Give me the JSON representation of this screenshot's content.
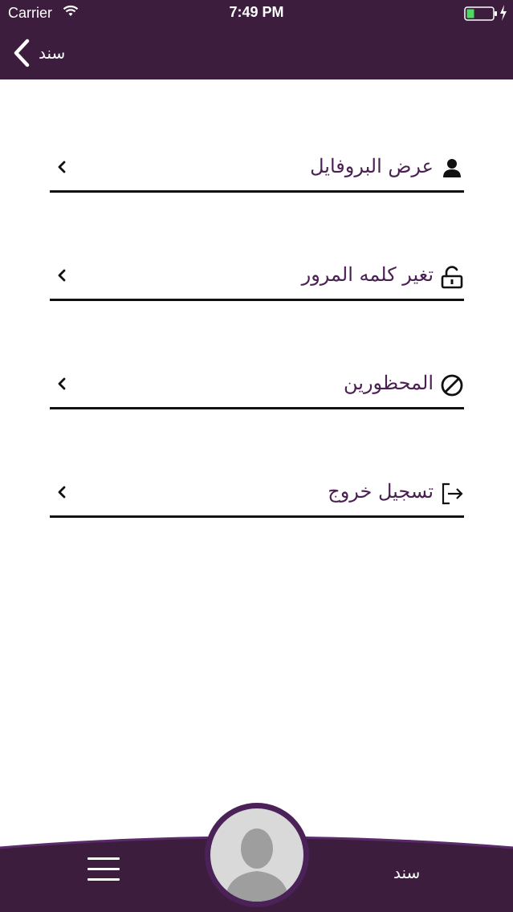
{
  "status_bar": {
    "carrier": "Carrier",
    "time": "7:49 PM"
  },
  "header": {
    "back_label": "سند"
  },
  "menu": {
    "items": [
      {
        "label": "عرض البروفايل",
        "icon": "user-icon"
      },
      {
        "label": "تغير كلمه المرور",
        "icon": "lock-icon"
      },
      {
        "label": "المحظورين",
        "icon": "blocked-icon"
      },
      {
        "label": "تسجيل خروج",
        "icon": "logout-icon"
      }
    ]
  },
  "bottom_bar": {
    "brand": "سند"
  },
  "colors": {
    "header_bg": "#3d1d3d",
    "accent": "#4a1f52",
    "battery_fill": "#4cd964"
  }
}
